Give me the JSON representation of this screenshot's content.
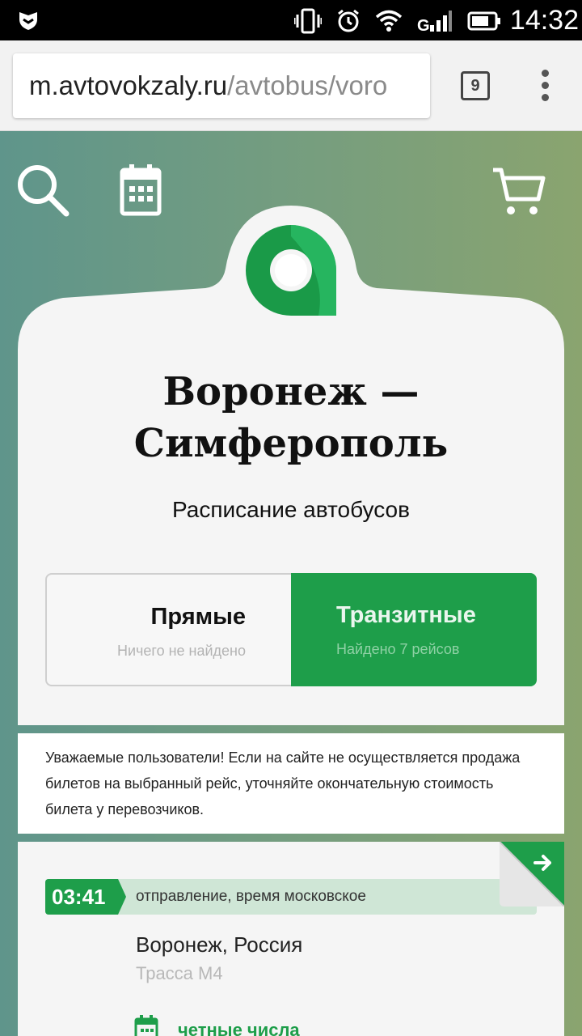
{
  "status_bar": {
    "time": "14:32",
    "icons": [
      "shield-icon",
      "vibrate-icon",
      "alarm-icon",
      "wifi-icon",
      "signal-icon",
      "battery-icon"
    ]
  },
  "browser": {
    "url_host": "m.avtovokzaly.ru",
    "url_path": "/avtobus/voro",
    "tab_count": "9"
  },
  "header_icons": [
    "search-icon",
    "calendar-icon",
    "cart-icon"
  ],
  "route": {
    "title_line1": "Воронеж —",
    "title_line2": "Симферополь",
    "subtitle": "Расписание автобусов"
  },
  "tabs": {
    "direct": {
      "label": "Прямые",
      "status": "Ничего не найдено"
    },
    "transit": {
      "label": "Транзитные",
      "status": "Найдено 7 рейсов"
    }
  },
  "notice": "Уважаемые пользователи! Если на сайте не осуществляется продажа билетов на выбранный рейс, уточняйте окончательную стоимость билета у перевозчиков.",
  "trip": {
    "departure_time": "03:41",
    "departure_label": "отправление, время московское",
    "city": "Воронеж, Россия",
    "station": "Трасса М4",
    "schedule": "четные числа"
  },
  "colors": {
    "accent_green": "#1e9e4a",
    "light_green": "#cfe6d6",
    "background_gradient_left": "#5f958b",
    "background_gradient_right": "#8aa46f"
  }
}
